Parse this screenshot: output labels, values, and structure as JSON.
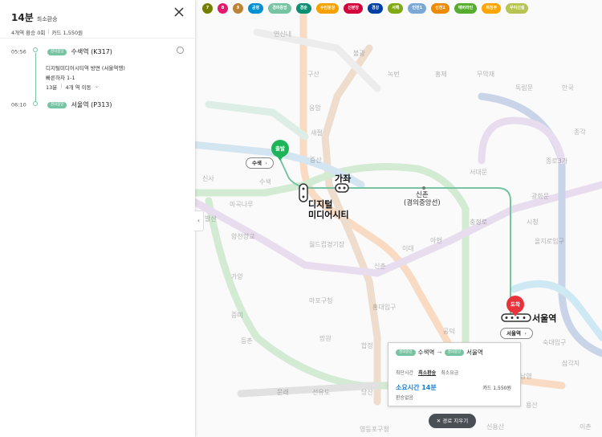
{
  "panel": {
    "duration": "14분",
    "mode": "최소환승",
    "summary_stops": "4개역 환승 0회",
    "summary_fare": "카드 1,550원",
    "start": {
      "time": "05:56",
      "line": "경의중앙",
      "station": "수색역 (K317)"
    },
    "direction": "디지털미디어시티역 방면 (서울역행)",
    "transfer_info": "빠른하차 1-1",
    "ride_time": "13분",
    "ride_stops": "4개 역 이동",
    "end": {
      "time": "06:10",
      "line": "경의중앙",
      "station": "서울역 (P313)"
    }
  },
  "linebar": [
    {
      "label": "7",
      "color": "#747f00"
    },
    {
      "label": "8",
      "color": "#e6186c"
    },
    {
      "label": "9",
      "color": "#bb8336"
    },
    {
      "label": "공항",
      "color": "#0090d2"
    },
    {
      "label": "경의중앙",
      "color": "#77c4a3"
    },
    {
      "label": "경춘",
      "color": "#0c8e72"
    },
    {
      "label": "수인분당",
      "color": "#f5a200"
    },
    {
      "label": "신분당",
      "color": "#d4003b"
    },
    {
      "label": "경강",
      "color": "#003da5"
    },
    {
      "label": "서해",
      "color": "#81a914"
    },
    {
      "label": "인천1",
      "color": "#7ca8d5"
    },
    {
      "label": "신천2",
      "color": "#ed8b00"
    },
    {
      "label": "에버라인",
      "color": "#56ad2d"
    },
    {
      "label": "의정부",
      "color": "#fda600"
    },
    {
      "label": "우이신설",
      "color": "#b7c452"
    }
  ],
  "map": {
    "start_pin": "출발",
    "end_pin": "도착",
    "start_station": "수색",
    "end_station": "서울역",
    "dmc": "디지털\n미디어시티",
    "gajwa": "가좌",
    "sinchon": "신촌\n(경의중앙선)",
    "seoul": "서울역",
    "bg_labels": [
      "연신내",
      "불광",
      "구산",
      "응암",
      "증산",
      "새절",
      "수색",
      "신사",
      "마곡나루",
      "발산",
      "양천향교",
      "가양",
      "증미",
      "등촌",
      "월드컵경기장",
      "마포구청",
      "망원",
      "합정",
      "홍대입구",
      "신촌",
      "이대",
      "아현",
      "충정로",
      "시청",
      "종로3가",
      "을지로입구",
      "서대문",
      "광화문",
      "공덕",
      "숙대입구",
      "삼각지",
      "용산",
      "남영",
      "신용산",
      "선유도",
      "당산",
      "영등포구청",
      "문래",
      "이촌",
      "녹번",
      "홍제",
      "무악재",
      "독립문",
      "안국",
      "종각"
    ]
  },
  "card": {
    "from_line": "경의중앙",
    "from": "수색역",
    "to_line": "경의중앙",
    "to": "서울역",
    "opt1": "최단시간",
    "opt2": "최소환승",
    "opt3": "최소요금",
    "duration": "소요시간 14분",
    "fare": "카드 1,550원",
    "transfer": "환승없음"
  },
  "clear_button": "경로 지우기",
  "colors": {
    "gyeongui": "#77c4a3",
    "start_pin": "#1eb45a",
    "end_pin": "#e8333c"
  }
}
